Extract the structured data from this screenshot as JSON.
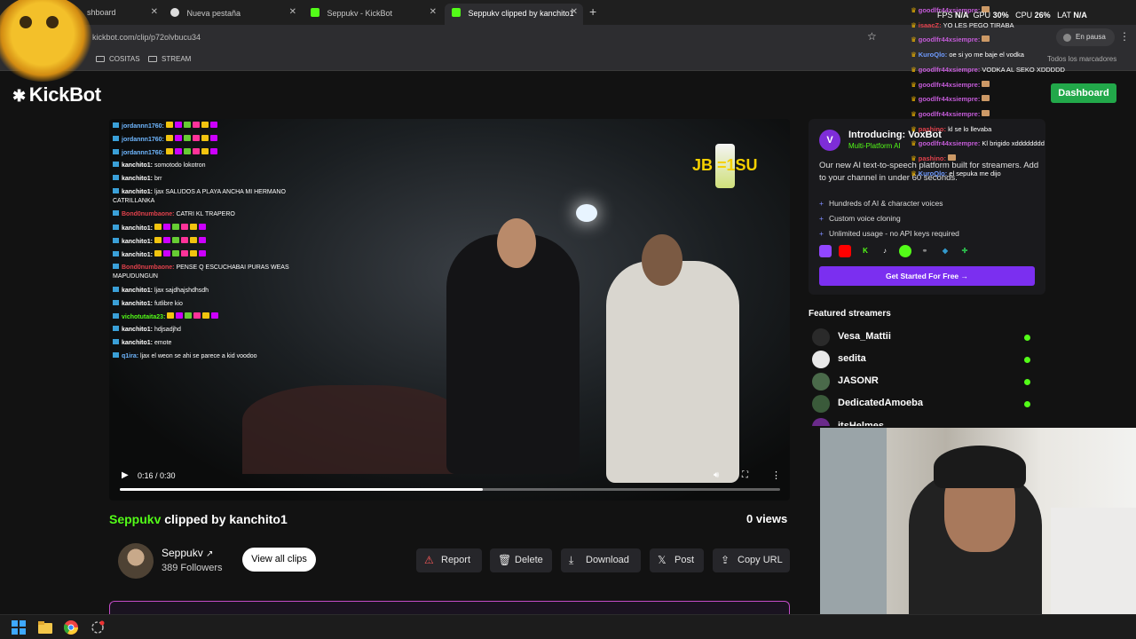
{
  "browser": {
    "tabs": [
      {
        "label": "shboard",
        "icon": "kickbot-icon"
      },
      {
        "label": "Nueva pestaña",
        "icon": "chrome-icon"
      },
      {
        "label": "Seppukv - KickBot",
        "icon": "kickbot-icon"
      },
      {
        "label": "Seppukv clipped by kanchito1",
        "icon": "kickbot-icon",
        "active": true
      }
    ],
    "url": "kickbot.com/clip/p72olvbucu34",
    "profile_status": "En pausa",
    "bookmarks": [
      "COSITAS",
      "STREAM"
    ],
    "all_bookmarks_label": "Todos los marcadores"
  },
  "site": {
    "logo": "KickBot",
    "dashboard_button": "Dashboard"
  },
  "video": {
    "time": "0:16 / 0:30",
    "progress": 0.55,
    "overlay_text": "JB  =1SU",
    "chat": [
      {
        "user": "jordannn1760:",
        "text": "",
        "color": "#6fb7ff"
      },
      {
        "user": "jordannn1760:",
        "text": "",
        "color": "#6fb7ff"
      },
      {
        "user": "jordannn1760:",
        "text": "",
        "color": "#6fb7ff"
      },
      {
        "user": "kanchito1:",
        "text": "somotodo lokotron",
        "color": "#ffffff"
      },
      {
        "user": "kanchito1:",
        "text": "brr",
        "color": "#ffffff"
      },
      {
        "user": "kanchito1:",
        "text": "ljax SALUDOS A PLAYA ANCHA MI HERMANO",
        "color": "#ffffff"
      },
      {
        "user": "",
        "text": "CATRILLANKA",
        "color": "#ffffff"
      },
      {
        "user": "Bond0numbaone:",
        "text": "CATRI KL TRAPERO",
        "color": "#e0414b"
      },
      {
        "user": "kanchito1:",
        "text": "",
        "color": "#ffffff"
      },
      {
        "user": "kanchito1:",
        "text": "",
        "color": "#ffffff"
      },
      {
        "user": "kanchito1:",
        "text": "",
        "color": "#ffffff"
      },
      {
        "user": "Bond0numbaone:",
        "text": "PENSE Q ESCUCHABAI PURAS WEAS",
        "color": "#e0414b"
      },
      {
        "user": "",
        "text": "MAPUDUNGUN",
        "color": "#ffffff"
      },
      {
        "user": "kanchito1:",
        "text": "ljax sajdhajshdhsdh",
        "color": "#ffffff"
      },
      {
        "user": "kanchito1:",
        "text": "futlibre kio",
        "color": "#ffffff"
      },
      {
        "user": "vichotutaita23:",
        "text": "",
        "color": "#53fc18"
      },
      {
        "user": "kanchito1:",
        "text": "hdjsadjhd",
        "color": "#ffffff"
      },
      {
        "user": "kanchito1:",
        "text": "emote",
        "color": "#ffffff"
      },
      {
        "user": "q1ira:",
        "text": "ljax el weon se ahi se parece a kid voodoo",
        "color": "#6fb7ff"
      }
    ]
  },
  "clip": {
    "channel": "Seppukv",
    "title_suffix": "clipped by kanchito1",
    "views": "0 views",
    "streamer_name": "Seppukv",
    "followers": "389 Followers",
    "view_all": "View all clips",
    "actions": [
      {
        "label": "Report",
        "icon": "warning-icon"
      },
      {
        "label": "Delete",
        "icon": "trash-icon"
      },
      {
        "label": "Download",
        "icon": "download-icon"
      },
      {
        "label": "Post",
        "icon": "x-logo-icon"
      },
      {
        "label": "Copy URL",
        "icon": "share-icon"
      }
    ]
  },
  "promo": {
    "title": "Introducing: VoxBot",
    "subtitle": "Multi-Platform AI",
    "description": "Our new AI text-to-speech platform built for streamers. Add to your channel in under 60 seconds.",
    "features": [
      "Hundreds of AI & character voices",
      "Custom voice cloning",
      "Unlimited usage - no API keys required"
    ],
    "cta": "Get Started For Free →"
  },
  "featured": {
    "heading": "Featured streamers",
    "streamers": [
      "Vesa_Mattii",
      "sedita",
      "JASONR",
      "DedicatedAmoeba",
      "itsHelmes"
    ]
  },
  "overlay_chat": {
    "stats": {
      "fps_label": "FPS",
      "fps": "N/A",
      "gpu_label": "GPU",
      "gpu": "30%",
      "cpu_label": "CPU",
      "cpu": "26%",
      "lat_label": "LAT",
      "lat": "N/A"
    },
    "messages": [
      {
        "user": "goodlfr44xsiempre:",
        "text": "",
        "color": "#c45bd8"
      },
      {
        "user": "isaacZ:",
        "text": "YO LES PEGO TIRABA",
        "color": "#e0414b"
      },
      {
        "user": "goodlfr44xsiempre:",
        "text": "",
        "color": "#c45bd8"
      },
      {
        "user": "KuroQlo:",
        "text": "oe si yo me baje el vodka",
        "color": "#6f9bff"
      },
      {
        "user": "goodlfr44xsiempre:",
        "text": "VODKA AL SEKO XDDDDD",
        "color": "#c45bd8"
      },
      {
        "user": "goodlfr44xsiempre:",
        "text": "",
        "color": "#c45bd8"
      },
      {
        "user": "goodlfr44xsiempre:",
        "text": "",
        "color": "#c45bd8"
      },
      {
        "user": "goodlfr44xsiempre:",
        "text": "",
        "color": "#c45bd8"
      },
      {
        "user": "pashino:",
        "text": "kl se lo llevaba",
        "color": "#e0414b"
      },
      {
        "user": "goodlfr44xsiempre:",
        "text": "Kl brigido xdddddddd",
        "color": "#c45bd8"
      },
      {
        "user": "pashino:",
        "text": "",
        "color": "#e0414b"
      },
      {
        "user": "KuroQlo:",
        "text": "el sepuka me dijo",
        "color": "#6f9bff"
      }
    ]
  },
  "colors": {
    "accent": "#53fc18",
    "brand_purple": "#7b2ff0",
    "dashboard_green": "#22a84a"
  }
}
